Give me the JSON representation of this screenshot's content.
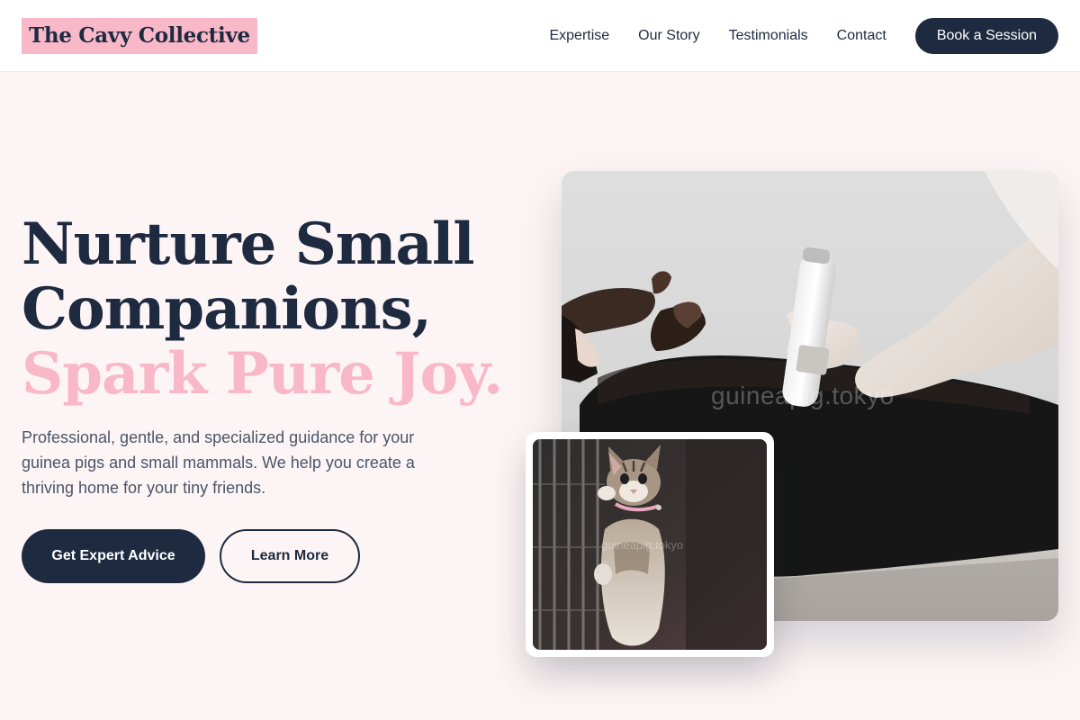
{
  "header": {
    "logo": "The Cavy Collective",
    "nav": [
      "Expertise",
      "Our Story",
      "Testimonials",
      "Contact"
    ],
    "cta": "Book a Session"
  },
  "hero": {
    "title_line1": "Nurture Small",
    "title_line2": "Companions,",
    "title_accent": "Spark Pure Joy.",
    "description": "Professional, gentle, and specialized guidance for your guinea pigs and small mammals. We help you create a thriving home for your tiny friends.",
    "primary_button": "Get Expert Advice",
    "secondary_button": "Learn More"
  },
  "images": {
    "main_watermark": "guineapig.tokyo",
    "inset_watermark": "guineapig.tokyo"
  },
  "colors": {
    "brand_navy": "#1e2a40",
    "accent_pink": "#f9b8c8",
    "page_bg": "#fdf5f5"
  }
}
